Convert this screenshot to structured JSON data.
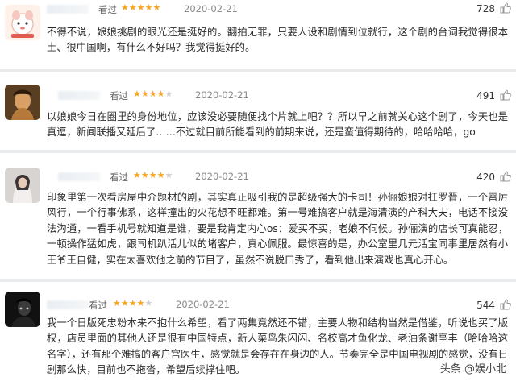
{
  "reviews": [
    {
      "label": "看过",
      "stars_filled": 5,
      "date": "2020-02-21",
      "votes": "728",
      "text": "不得不说，娘娘挑剧的眼光还是挺好的。翻拍无罪，只要人设和剧情到位就行，这个剧的台词我觉得很本土、很中国啊，有什么不好吗？我觉得挺好的。"
    },
    {
      "label": "看过",
      "stars_filled": 4,
      "date": "2020-02-21",
      "votes": "491",
      "text": "以娘娘今日在圈里的身份地位，应该没必要随便找个片就上吧？？所以早之前就关心这个剧了，今天也是真逗，新闻联播又延后了……不过就目前所能看到的前期来说，还是蛮值得期待的，哈哈哈哈，go"
    },
    {
      "label": "看过",
      "stars_filled": 4,
      "date": "2020-02-21",
      "votes": "420",
      "text": "印象里第一次看房屋中介题材的剧，其实真正吸引我的是超级强大的卡司！孙俪娘娘对扛罗晋，一个雷厉风行，一个行事佛系，这样撞出的火花想不旺都难。第一号难搞客户就是海清演的产科大夫，电话不接没法沟通，一看手机号就知道是谁，要是我肯定内心os：爱买不买，老娘不伺候。孙俪演的店长可真能忍，一顿操作猛如虎，跟司机趴活儿似的堵客户，真心佩服。最惊喜的是，办公室里几元活宝同事里居然有小王爷王自健，实在太喜欢他之前的节目了，虽然不说脱口秀了，看到他出来演戏也真心开心。"
    },
    {
      "label": "看过",
      "stars_filled": 4,
      "date": "2020-02-21",
      "votes": "544",
      "text": "我一个日版死忠粉本来不抱什么希望，看了两集竟然还不错，主要人物和结构当然是借鉴，听说也买了版权，店员里面的其他人还是很有中国特点，新人菜鸟朱闪闪、名校高才鱼化龙、老油条谢亭丰（哈哈哈这名字），还有那个难搞的客户宫医生，感觉就是会存在在身边的人。节奏完全是中国电视剧的感觉，没有日剧那么快，目前也不拖沓，希望后续撑住吧。"
    }
  ],
  "watermark": {
    "prefix": "头条",
    "handle": "@娱小北"
  },
  "colors": {
    "star": "#f5a623",
    "star_off": "#cfcfcf",
    "divider": "#e9eaec"
  }
}
